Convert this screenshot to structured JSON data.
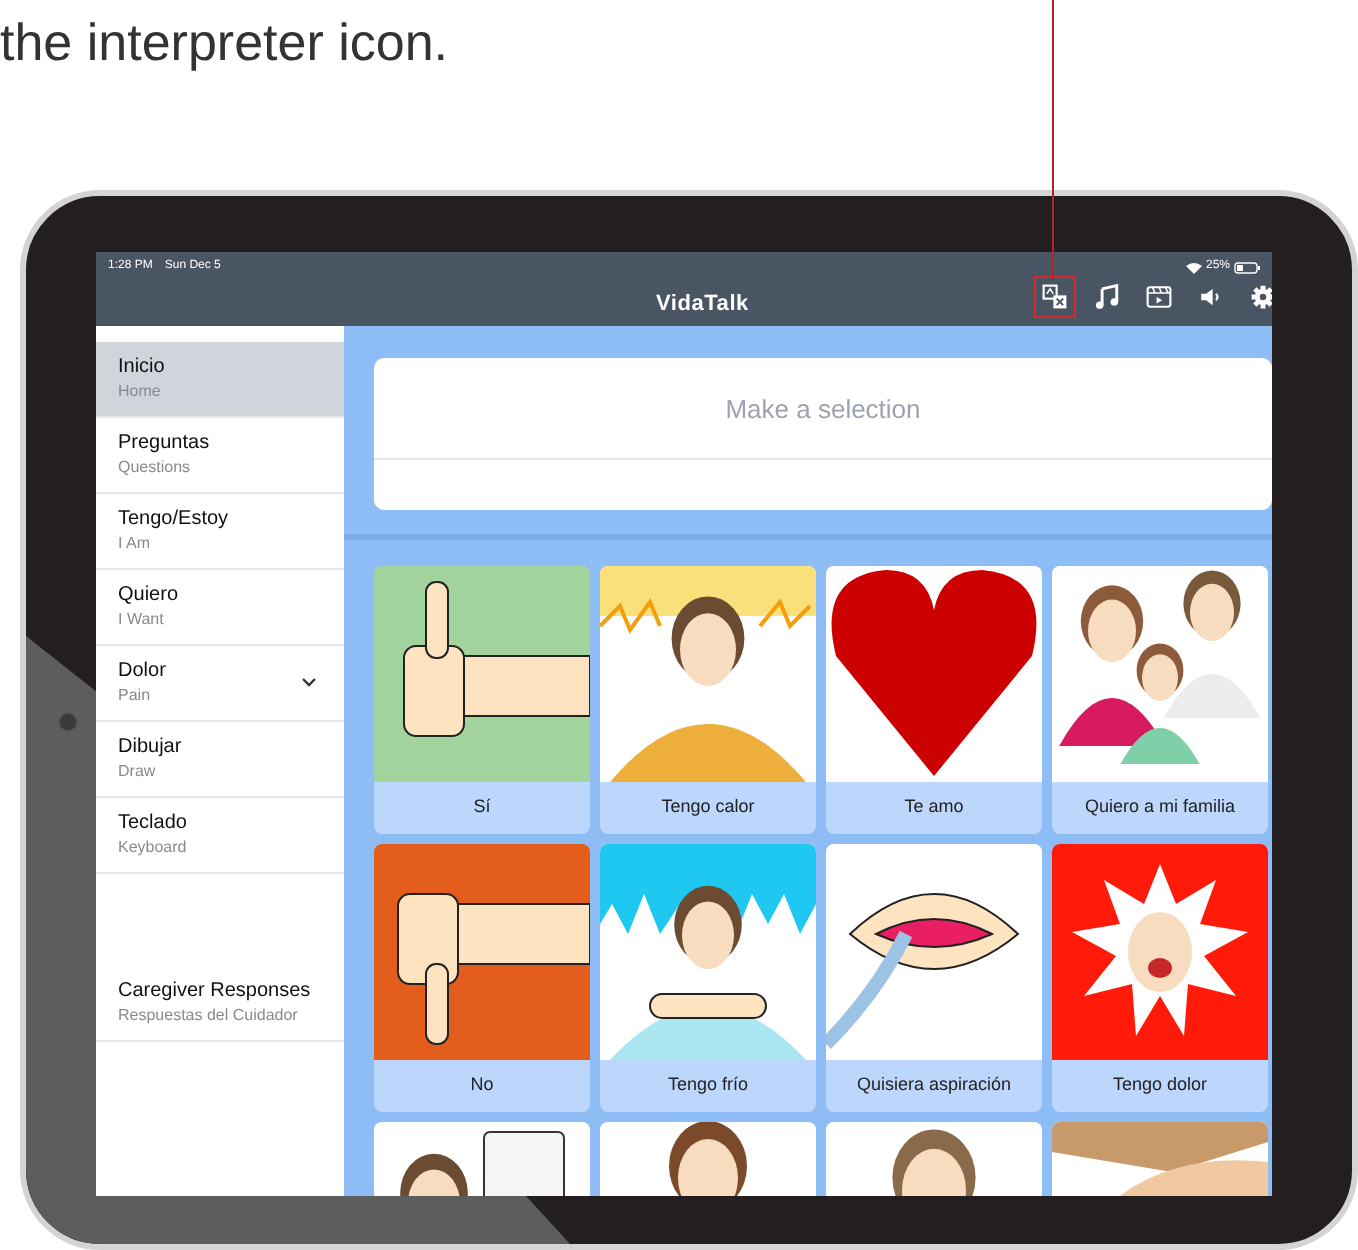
{
  "caption": "the interpreter icon.",
  "status_bar": {
    "time": "1:28 PM",
    "date": "Sun Dec 5",
    "battery": "25%"
  },
  "window": {
    "title": "VidaTalk"
  },
  "toolbar": [
    {
      "kind": "interpreter",
      "highlighted": true
    },
    {
      "kind": "music",
      "highlighted": false
    },
    {
      "kind": "video",
      "highlighted": false
    },
    {
      "kind": "sound",
      "highlighted": false
    },
    {
      "kind": "settings",
      "highlighted": false
    }
  ],
  "sidebar": {
    "items": [
      {
        "label": "Inicio",
        "sublabel": "Home",
        "selected": true,
        "has_submenu": false
      },
      {
        "label": "Preguntas",
        "sublabel": "Questions",
        "selected": false,
        "has_submenu": false
      },
      {
        "label": "Tengo/Estoy",
        "sublabel": "I Am",
        "selected": false,
        "has_submenu": false
      },
      {
        "label": "Quiero",
        "sublabel": "I Want",
        "selected": false,
        "has_submenu": false
      },
      {
        "label": "Dolor",
        "sublabel": "Pain",
        "selected": false,
        "has_submenu": true
      },
      {
        "label": "Dibujar",
        "sublabel": "Draw",
        "selected": false,
        "has_submenu": false
      },
      {
        "label": "Teclado",
        "sublabel": "Keyboard",
        "selected": false,
        "has_submenu": false
      }
    ],
    "footer_item": {
      "label": "Caregiver Responses",
      "sublabel": "Respuestas del Cuidador",
      "selected": false
    }
  },
  "selection": {
    "placeholder": "Make a selection"
  },
  "tiles": [
    {
      "kind": "picture",
      "label": "Sí"
    },
    {
      "kind": "picture",
      "label": "Tengo calor"
    },
    {
      "kind": "picture",
      "label": "Te amo"
    },
    {
      "kind": "picture",
      "label": "Quiero a mi familia"
    },
    {
      "kind": "picture",
      "label": "No"
    },
    {
      "kind": "picture",
      "label": "Tengo frío"
    },
    {
      "kind": "picture",
      "label": "Quisiera aspiración"
    },
    {
      "kind": "picture",
      "label": "Tengo dolor"
    },
    {
      "kind": "picture"
    },
    {
      "kind": "picture"
    },
    {
      "kind": "picture"
    },
    {
      "kind": "picture"
    }
  ]
}
